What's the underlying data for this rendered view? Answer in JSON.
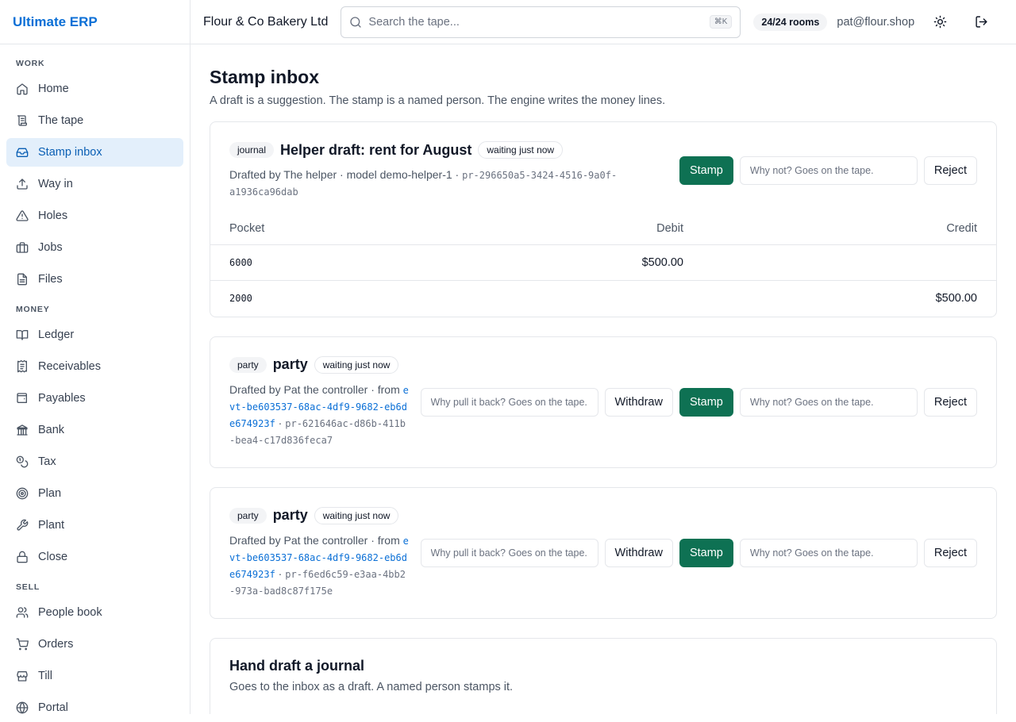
{
  "app": {
    "brand": "Ultimate ERP"
  },
  "topbar": {
    "org": "Flour & Co Bakery Ltd",
    "search_placeholder": "Search the tape...",
    "shortcut": "⌘K",
    "rooms": "24/24 rooms",
    "email": "pat@flour.shop"
  },
  "sidebar": {
    "sections": [
      {
        "label": "WORK",
        "items": [
          {
            "label": "Home",
            "icon": "home-icon"
          },
          {
            "label": "The tape",
            "icon": "scroll-icon"
          },
          {
            "label": "Stamp inbox",
            "icon": "inbox-icon",
            "active": true
          },
          {
            "label": "Way in",
            "icon": "upload-icon"
          },
          {
            "label": "Holes",
            "icon": "warning-icon"
          },
          {
            "label": "Jobs",
            "icon": "briefcase-icon"
          },
          {
            "label": "Files",
            "icon": "file-icon"
          }
        ]
      },
      {
        "label": "MONEY",
        "items": [
          {
            "label": "Ledger",
            "icon": "book-icon"
          },
          {
            "label": "Receivables",
            "icon": "receipt-icon"
          },
          {
            "label": "Payables",
            "icon": "wallet-icon"
          },
          {
            "label": "Bank",
            "icon": "bank-icon"
          },
          {
            "label": "Tax",
            "icon": "coins-icon"
          },
          {
            "label": "Plan",
            "icon": "target-icon"
          },
          {
            "label": "Plant",
            "icon": "wrench-icon"
          },
          {
            "label": "Close",
            "icon": "lock-icon"
          }
        ]
      },
      {
        "label": "SELL",
        "items": [
          {
            "label": "People book",
            "icon": "users-icon"
          },
          {
            "label": "Orders",
            "icon": "cart-icon"
          },
          {
            "label": "Till",
            "icon": "store-icon"
          },
          {
            "label": "Portal",
            "icon": "globe-icon"
          }
        ]
      }
    ]
  },
  "page": {
    "title": "Stamp inbox",
    "subtitle": "A draft is a suggestion. The stamp is a named person. The engine writes the money lines."
  },
  "cards": [
    {
      "tag": "journal",
      "title": "Helper draft: rent for August",
      "status": "waiting just now",
      "meta_text": "Drafted by The helper · model demo-helper-1 · ",
      "meta_id": "pr-296650a5-3424-4516-9a0f-a1936ca96dab",
      "stamp_label": "Stamp",
      "reject_placeholder": "Why not? Goes on the tape.",
      "reject_label": "Reject",
      "table": {
        "headers": [
          "Pocket",
          "Debit",
          "Credit"
        ],
        "rows": [
          {
            "pocket": "6000",
            "debit": "$500.00",
            "credit": ""
          },
          {
            "pocket": "2000",
            "debit": "",
            "credit": "$500.00"
          }
        ]
      }
    },
    {
      "tag": "party",
      "title": "party",
      "status": "waiting just now",
      "meta_text": "Drafted by Pat the controller · from ",
      "meta_link": "evt-be603537-68ac-4df9-9682-eb6de674923f",
      "meta_sep": " · ",
      "meta_id": "pr-621646ac-d86b-411b-bea4-c17d836feca7",
      "withdraw_placeholder": "Why pull it back? Goes on the tape.",
      "withdraw_label": "Withdraw",
      "stamp_label": "Stamp",
      "reject_placeholder": "Why not? Goes on the tape.",
      "reject_label": "Reject"
    },
    {
      "tag": "party",
      "title": "party",
      "status": "waiting just now",
      "meta_text": "Drafted by Pat the controller · from ",
      "meta_link": "evt-be603537-68ac-4df9-9682-eb6de674923f",
      "meta_sep": " · ",
      "meta_id": "pr-f6ed6c59-e3aa-4bb2-973a-bad8c87f175e",
      "withdraw_placeholder": "Why pull it back? Goes on the tape.",
      "withdraw_label": "Withdraw",
      "stamp_label": "Stamp",
      "reject_placeholder": "Why not? Goes on the tape.",
      "reject_label": "Reject"
    }
  ],
  "hand_draft": {
    "title": "Hand draft a journal",
    "subtitle": "Goes to the inbox as a draft. A named person stamps it."
  }
}
